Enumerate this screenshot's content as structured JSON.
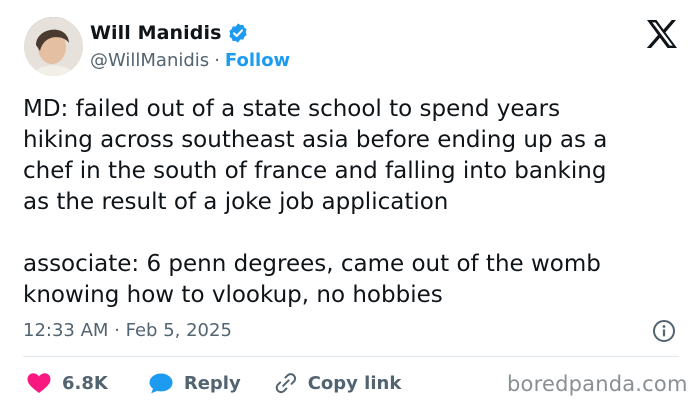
{
  "author": {
    "name": "Will Manidis",
    "handle": "@WillManidis",
    "separator": "·",
    "follow_label": "Follow"
  },
  "tweet": {
    "text": "MD: failed out of a state school to spend years\nhiking across southeast asia before ending up as a\nchef in the south of france and falling into banking\nas the result of a joke job application\n\nassociate: 6 penn degrees, came out of the womb\nknowing how to vlookup, no hobbies",
    "timestamp": "12:33 AM · Feb 5, 2025"
  },
  "actions": {
    "like_count": "6.8K",
    "reply_label": "Reply",
    "copy_link_label": "Copy link"
  },
  "watermark": "boredpanda.com",
  "colors": {
    "accent": "#1d9bf0",
    "like": "#f91880",
    "text": "#0f1419",
    "secondary": "#536471"
  },
  "icons": [
    "verified-badge-icon",
    "x-logo-icon",
    "info-icon",
    "heart-icon",
    "reply-bubble-icon",
    "link-icon"
  ]
}
